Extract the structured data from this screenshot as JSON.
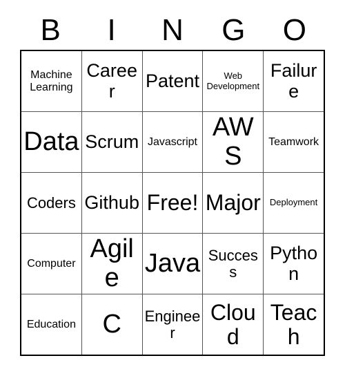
{
  "card": {
    "header_letters": [
      "B",
      "I",
      "N",
      "G",
      "O"
    ],
    "rows": [
      [
        {
          "text": "Machine Learning",
          "size": "sm"
        },
        {
          "text": "Career",
          "size": "lg"
        },
        {
          "text": "Patent",
          "size": "lg"
        },
        {
          "text": "Web Development",
          "size": "xs"
        },
        {
          "text": "Failure",
          "size": "lg"
        }
      ],
      [
        {
          "text": "Data",
          "size": "xxl"
        },
        {
          "text": "Scrum",
          "size": "lg"
        },
        {
          "text": "Javascript",
          "size": "sm"
        },
        {
          "text": "AWS",
          "size": "xxl"
        },
        {
          "text": "Teamwork",
          "size": "sm"
        }
      ],
      [
        {
          "text": "Coders",
          "size": "md"
        },
        {
          "text": "Github",
          "size": "lg"
        },
        {
          "text": "Free!",
          "size": "xl"
        },
        {
          "text": "Major",
          "size": "xl"
        },
        {
          "text": "Deployment",
          "size": "xs"
        }
      ],
      [
        {
          "text": "Computer",
          "size": "sm"
        },
        {
          "text": "Agile",
          "size": "xxl"
        },
        {
          "text": "Java",
          "size": "xxl"
        },
        {
          "text": "Success",
          "size": "md"
        },
        {
          "text": "Python",
          "size": "lg"
        }
      ],
      [
        {
          "text": "Education",
          "size": "sm"
        },
        {
          "text": "C",
          "size": "xxl"
        },
        {
          "text": "Engineer",
          "size": "md"
        },
        {
          "text": "Cloud",
          "size": "xl"
        },
        {
          "text": "Teach",
          "size": "xl"
        }
      ]
    ]
  }
}
